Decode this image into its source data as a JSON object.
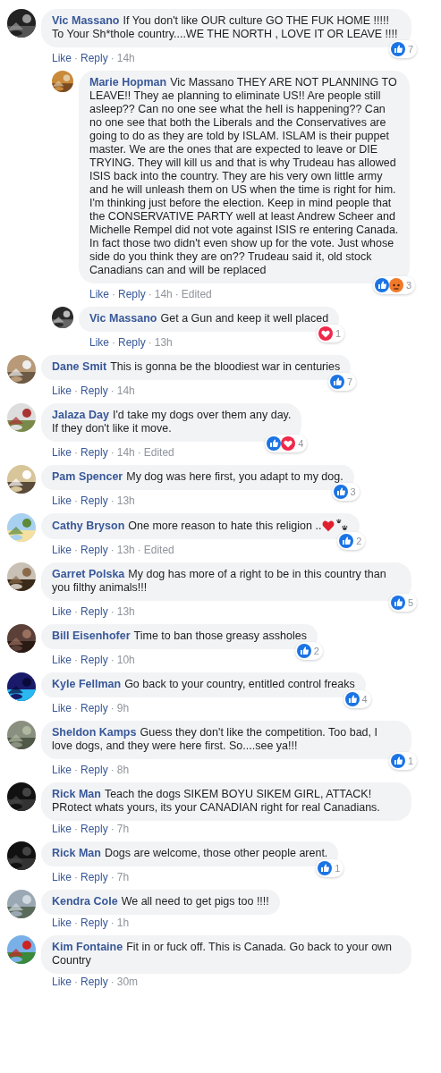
{
  "separator": "·",
  "comments": [
    {
      "author": "Vic Massano",
      "text": "If You don't like OUR culture GO THE FUK HOME !!!!! To Your Sh*thole country....WE THE NORTH , LOVE IT OR LEAVE !!!!",
      "reactions": [
        {
          "kind": "like"
        }
      ],
      "reaction_count": "7",
      "actions": [
        "Like",
        "Reply"
      ],
      "time": "14h",
      "replies": [
        {
          "author": "Marie Hopman",
          "text": "Vic Massano THEY ARE NOT PLANNING TO LEAVE!! They ae planning to eliminate US!! Are people still asleep?? Can no one see what the hell is happening?? Can no one see that both the Liberals and the Conservatives are going to do as they are told by ISLAM. ISLAM is their puppet master. We are the ones that are expected to leave or DIE TRYING. They will kill us and that is why Trudeau has allowed ISIS back into the country. They are his very own little army and he will unleash them on US when the time is right for him. I'm thinking just before the election. Keep in mind people that the CONSERVATIVE PARTY well at least Andrew Scheer and Michelle Rempel did not vote against ISIS re entering Canada. In fact those two didn't even show up for the vote. Just whose side do you think they are on?? Trudeau said it, old stock Canadians can and will be replaced",
          "reactions": [
            {
              "kind": "like"
            },
            {
              "kind": "angry"
            }
          ],
          "reaction_count": "3",
          "actions": [
            "Like",
            "Reply"
          ],
          "time": "14h",
          "edited": "Edited"
        },
        {
          "author": "Vic Massano",
          "text": "Get a Gun and keep it well placed",
          "reactions": [
            {
              "kind": "love"
            }
          ],
          "reaction_count": "1",
          "actions": [
            "Like",
            "Reply"
          ],
          "time": "13h"
        }
      ]
    },
    {
      "author": "Dane Smit",
      "text": "This is gonna be the bloodiest war in centuries",
      "reactions": [
        {
          "kind": "like"
        }
      ],
      "reaction_count": "7",
      "actions": [
        "Like",
        "Reply"
      ],
      "time": "14h"
    },
    {
      "author": "Jalaza Day",
      "text": "I'd take my dogs over them any day.\nIf they don't like it move.",
      "reactions": [
        {
          "kind": "like"
        },
        {
          "kind": "love"
        }
      ],
      "reaction_count": "4",
      "actions": [
        "Like",
        "Reply"
      ],
      "time": "14h",
      "edited": "Edited"
    },
    {
      "author": "Pam Spencer",
      "text": "My dog was here first, you adapt to my dog.",
      "reactions": [
        {
          "kind": "like"
        }
      ],
      "reaction_count": "3",
      "actions": [
        "Like",
        "Reply"
      ],
      "time": "13h"
    },
    {
      "author": "Cathy Bryson",
      "text": "One more reason to hate this religion ..",
      "stickers": [
        {
          "kind": "heart"
        },
        {
          "kind": "paw"
        }
      ],
      "reactions": [
        {
          "kind": "like"
        }
      ],
      "reaction_count": "2",
      "actions": [
        "Like",
        "Reply"
      ],
      "time": "13h",
      "edited": "Edited"
    },
    {
      "author": "Garret Polska",
      "text": "My dog has more of a right to be in this country than you filthy animals!!!",
      "reactions": [
        {
          "kind": "like"
        }
      ],
      "reaction_count": "5",
      "actions": [
        "Like",
        "Reply"
      ],
      "time": "13h"
    },
    {
      "author": "Bill Eisenhofer",
      "text": "Time to ban those greasy assholes",
      "reactions": [
        {
          "kind": "like"
        }
      ],
      "reaction_count": "2",
      "actions": [
        "Like",
        "Reply"
      ],
      "time": "10h"
    },
    {
      "author": "Kyle Fellman",
      "text": "Go back to your country, entitled control freaks",
      "reactions": [
        {
          "kind": "like"
        }
      ],
      "reaction_count": "4",
      "actions": [
        "Like",
        "Reply"
      ],
      "time": "9h"
    },
    {
      "author": "Sheldon Kamps",
      "text": "Guess they don't like the competition. Too bad, I love dogs, and they were here first. So....see ya!!!",
      "reactions": [
        {
          "kind": "like"
        }
      ],
      "reaction_count": "1",
      "actions": [
        "Like",
        "Reply"
      ],
      "time": "8h"
    },
    {
      "author": "Rick Man",
      "text": "Teach the dogs SIKEM BOYU SIKEM GIRL, ATTACK! PRotect whats yours, its your CANADIAN right for real Canadians.",
      "actions": [
        "Like",
        "Reply"
      ],
      "time": "7h"
    },
    {
      "author": "Rick Man",
      "text": "Dogs are welcome, those other people arent.",
      "reactions": [
        {
          "kind": "like"
        }
      ],
      "reaction_count": "1",
      "actions": [
        "Like",
        "Reply"
      ],
      "time": "7h"
    },
    {
      "author": "Kendra Cole",
      "text": "We all need to get pigs too !!!!",
      "actions": [
        "Like",
        "Reply"
      ],
      "time": "1h"
    },
    {
      "author": "Kim Fontaine",
      "text": "Fit in or fuck off. This is Canada. Go back to your own Country",
      "actions": [
        "Like",
        "Reply"
      ],
      "time": "30m"
    }
  ]
}
